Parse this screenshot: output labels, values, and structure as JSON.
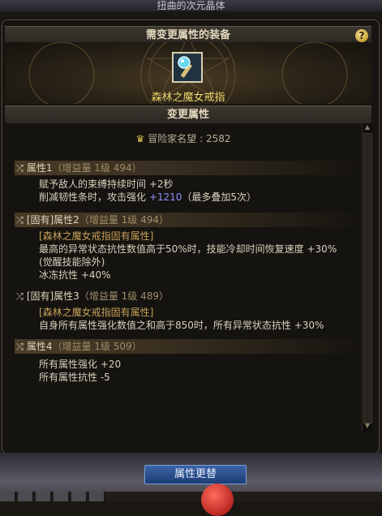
{
  "window": {
    "title": "扭曲的次元晶体"
  },
  "equipment_section": {
    "title": "需变更属性的装备",
    "help_icon": "?",
    "item": {
      "name": "森林之魔女戒指",
      "icon": "ring-icon"
    }
  },
  "attributes_section": {
    "title": "变更属性",
    "fame": {
      "label": "冒险家名望 : 2582",
      "icon": "crown-icon"
    },
    "attributes": [
      {
        "head": "属性1",
        "gain": "（增益量 1级 494）",
        "lines": [
          {
            "text": "赋予敌人的束缚持续时间 +2秒"
          },
          {
            "text": "削减韧性条时，攻击强化 ",
            "blue": "+1210",
            "suffix": "（最多叠加5次）"
          }
        ]
      },
      {
        "head": "[固有]属性2",
        "gain": "（增益量 1级 494）",
        "lines": [
          {
            "text": "[森林之魔女戒指固有属性]"
          },
          {
            "text": "最高的异常状态抗性数值高于50%时，技能冷却时间恢复速度 +30%"
          },
          {
            "text": "(觉醒技能除外)"
          },
          {
            "text": "冰冻抗性 +40%"
          }
        ]
      },
      {
        "head": "[固有]属性3",
        "gain": "（增益量 1级 489）",
        "lines": [
          {
            "text": "[森林之魔女戒指固有属性]"
          },
          {
            "text": "自身所有属性强化数值之和高于850时，所有异常状态抗性 +30%"
          }
        ]
      },
      {
        "head": "属性4",
        "gain": "（增益量 1级 509）",
        "lines": [
          {
            "text": "所有属性强化 +20"
          },
          {
            "text": "所有属性抗性 -5"
          }
        ]
      }
    ]
  },
  "buttons": {
    "change": "属性更替"
  },
  "colors": {
    "item_name": "#e9d56a",
    "accent_blue": "#8f8fff",
    "button": "#2a4f8e"
  }
}
